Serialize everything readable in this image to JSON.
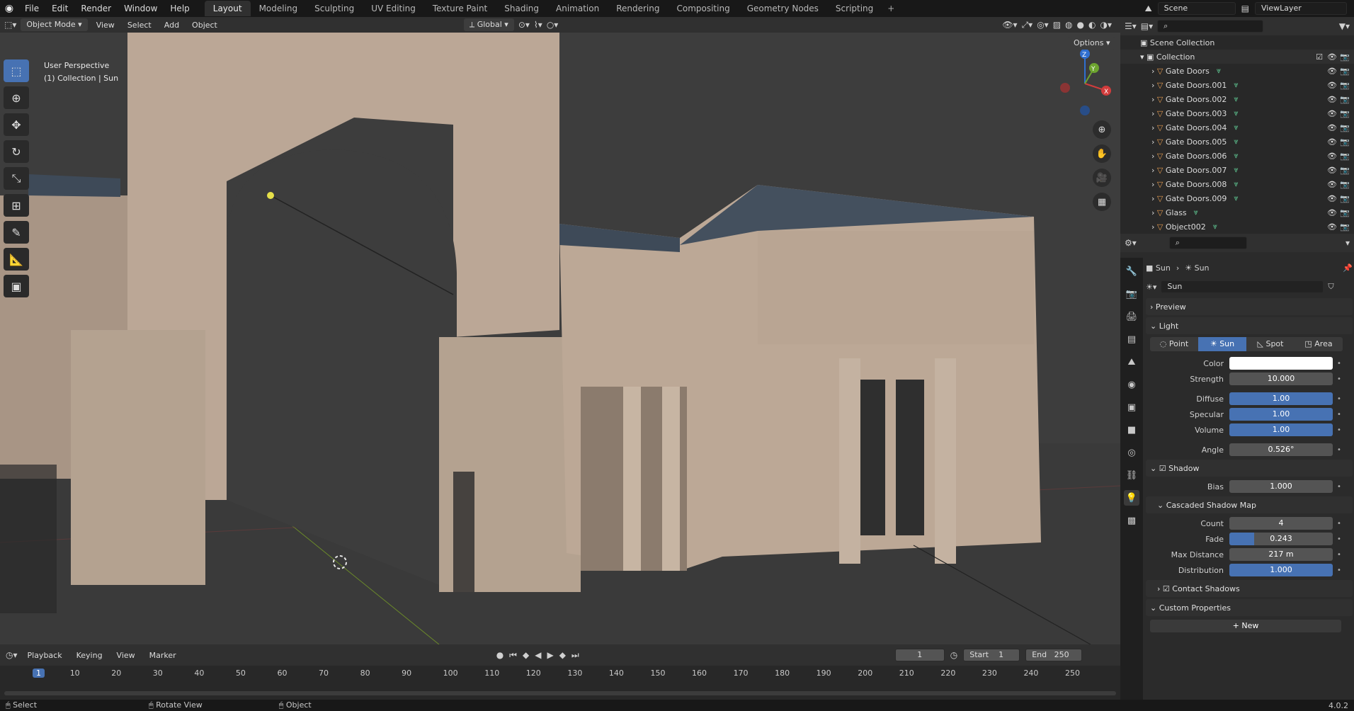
{
  "app": {
    "menus": [
      "File",
      "Edit",
      "Render",
      "Window",
      "Help"
    ],
    "workspaces": [
      "Layout",
      "Modeling",
      "Sculpting",
      "UV Editing",
      "Texture Paint",
      "Shading",
      "Animation",
      "Rendering",
      "Compositing",
      "Geometry Nodes",
      "Scripting"
    ],
    "active_workspace": "Layout",
    "scene": "Scene",
    "view_layer": "ViewLayer"
  },
  "viewport_header": {
    "mode": "Object Mode",
    "menus": [
      "View",
      "Select",
      "Add",
      "Object"
    ],
    "orientation": "Global",
    "options": "Options"
  },
  "viewport": {
    "perspective": "User Perspective",
    "context": "(1) Collection | Sun",
    "gizmo_axes": [
      "X",
      "Y",
      "Z"
    ]
  },
  "outliner": {
    "root": "Scene Collection",
    "collection": "Collection",
    "items": [
      "Gate Doors",
      "Gate Doors.001",
      "Gate Doors.002",
      "Gate Doors.003",
      "Gate Doors.004",
      "Gate Doors.005",
      "Gate Doors.006",
      "Gate Doors.007",
      "Gate Doors.008",
      "Gate Doors.009",
      "Glass",
      "Object002"
    ]
  },
  "properties": {
    "breadcrumb": [
      "Sun",
      "Sun"
    ],
    "datablock": "Sun",
    "sections": {
      "preview": "Preview",
      "light": "Light",
      "shadow": "Shadow",
      "cascaded": "Cascaded Shadow Map",
      "contact": "Contact Shadows",
      "custom": "Custom Properties"
    },
    "light_types": [
      "Point",
      "Sun",
      "Spot",
      "Area"
    ],
    "active_light_type": "Sun",
    "light_fields": [
      {
        "label": "Color",
        "value": ""
      },
      {
        "label": "Strength",
        "value": "10.000"
      },
      {
        "label": "Diffuse",
        "value": "1.00"
      },
      {
        "label": "Specular",
        "value": "1.00"
      },
      {
        "label": "Volume",
        "value": "1.00"
      },
      {
        "label": "Angle",
        "value": "0.526°"
      }
    ],
    "shadow_bias": {
      "label": "Bias",
      "value": "1.000"
    },
    "cascade_fields": [
      {
        "label": "Count",
        "value": "4"
      },
      {
        "label": "Fade",
        "value": "0.243"
      },
      {
        "label": "Max Distance",
        "value": "217 m"
      },
      {
        "label": "Distribution",
        "value": "1.000"
      }
    ],
    "new_button": "New"
  },
  "timeline": {
    "menus": [
      "Playback",
      "Keying",
      "View",
      "Marker"
    ],
    "current_frame": "1",
    "start_label": "Start",
    "start": "1",
    "end_label": "End",
    "end": "250",
    "ticks": [
      "1",
      "10",
      "20",
      "30",
      "40",
      "50",
      "60",
      "70",
      "80",
      "90",
      "100",
      "110",
      "120",
      "130",
      "140",
      "150",
      "160",
      "170",
      "180",
      "190",
      "200",
      "210",
      "220",
      "230",
      "240",
      "250"
    ]
  },
  "statusbar": {
    "items": [
      "Select",
      "Rotate View",
      "Object"
    ],
    "version": "4.0.2"
  },
  "colors": {
    "accent": "#4772b3",
    "viewport_bg": "#3d3d3d",
    "panel_bg": "#2b2b2b"
  }
}
